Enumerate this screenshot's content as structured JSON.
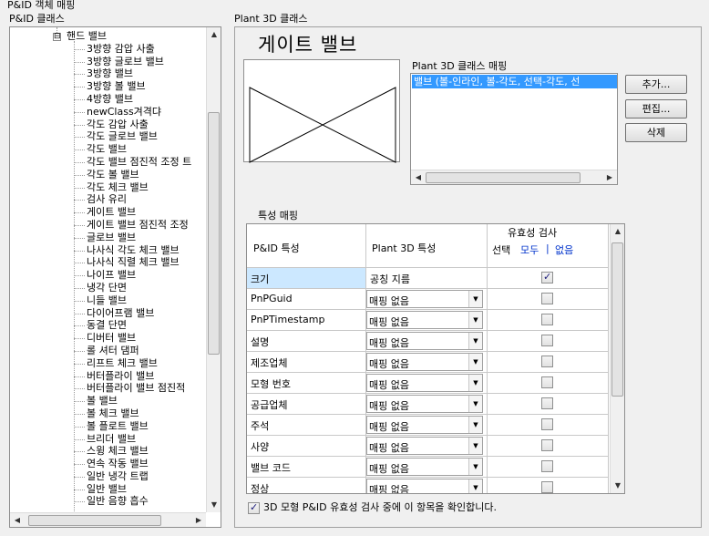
{
  "window": {
    "title": "P&ID 객체 매핑"
  },
  "left": {
    "label": "P&ID 클래스",
    "root": {
      "label": "핸드 밸브",
      "expander": "⊟"
    },
    "items": [
      "3방향 감압 사출",
      "3방향 글로브 밸브",
      "3방향 밸브",
      "3방향 볼 밸브",
      "4방향 밸브",
      "newClass겨격댜",
      "각도 감압 사출",
      "각도 글로브 밸브",
      "각도 밸브",
      "각도 밸브 점진적 조정 트",
      "각도 볼 밸브",
      "각도 체크 밸브",
      "검사 유리",
      "게이트 밸브",
      "게이트 밸브 점진적 조정",
      "글로브 밸브",
      "나사식 각도 체크 밸브",
      "나사식 직렬 체크 밸브",
      "나이프 밸브",
      "냉각 단면",
      "니들 밸브",
      "다이어프램 밸브",
      "동결 단면",
      "디버터 밸브",
      "롤 셔터 댐퍼",
      "리프트 체크 밸브",
      "버터플라이 밸브",
      "버터플라이 밸브 점진적",
      "볼 밸브",
      "볼 체크 밸브",
      "볼 플로트 밸브",
      "브리더 밸브",
      "스윙 체크 밸브",
      "연속 작동 밸브",
      "일반 냉각 트랩",
      "일반 밸브",
      "일반 음향 흡수"
    ]
  },
  "right": {
    "label": "Plant 3D 클래스",
    "class_title": "게이트 밸브",
    "mapping_label": "Plant 3D 클래스 매핑",
    "mapping_item": "밸브 (볼-인라인, 볼-각도, 선택-각도, 선",
    "buttons": {
      "add": "추가...",
      "edit": "편집...",
      "delete": "삭제"
    },
    "prop_label": "특성 매핑",
    "grid": {
      "col1": "P&ID 특성",
      "col2": "Plant 3D 특성",
      "col3_title": "유효성 검사",
      "col3_select": "선택",
      "col3_all": "모두",
      "col3_sep": "|",
      "col3_none": "없음",
      "rows": [
        {
          "pid": "크기",
          "p3d": "공칭 지름",
          "combo": false,
          "checked": true
        },
        {
          "pid": "PnPGuid",
          "p3d": "매핑 없음",
          "combo": true,
          "checked": false
        },
        {
          "pid": "PnPTimestamp",
          "p3d": "매핑 없음",
          "combo": true,
          "checked": false
        },
        {
          "pid": "설명",
          "p3d": "매핑 없음",
          "combo": true,
          "checked": false
        },
        {
          "pid": "제조업체",
          "p3d": "매핑 없음",
          "combo": true,
          "checked": false
        },
        {
          "pid": "모형 번호",
          "p3d": "매핑 없음",
          "combo": true,
          "checked": false
        },
        {
          "pid": "공급업체",
          "p3d": "매핑 없음",
          "combo": true,
          "checked": false
        },
        {
          "pid": "주석",
          "p3d": "매핑 없음",
          "combo": true,
          "checked": false
        },
        {
          "pid": "사양",
          "p3d": "매핑 없음",
          "combo": true,
          "checked": false
        },
        {
          "pid": "밸브 코드",
          "p3d": "매핑 없음",
          "combo": true,
          "checked": false
        },
        {
          "pid": "정상",
          "p3d": "매핑 없음",
          "combo": true,
          "checked": false
        }
      ]
    },
    "footer_check": {
      "checked": true,
      "label": "3D 모형 P&ID 유효성 검사 중에 이 항목을 확인합니다."
    }
  }
}
